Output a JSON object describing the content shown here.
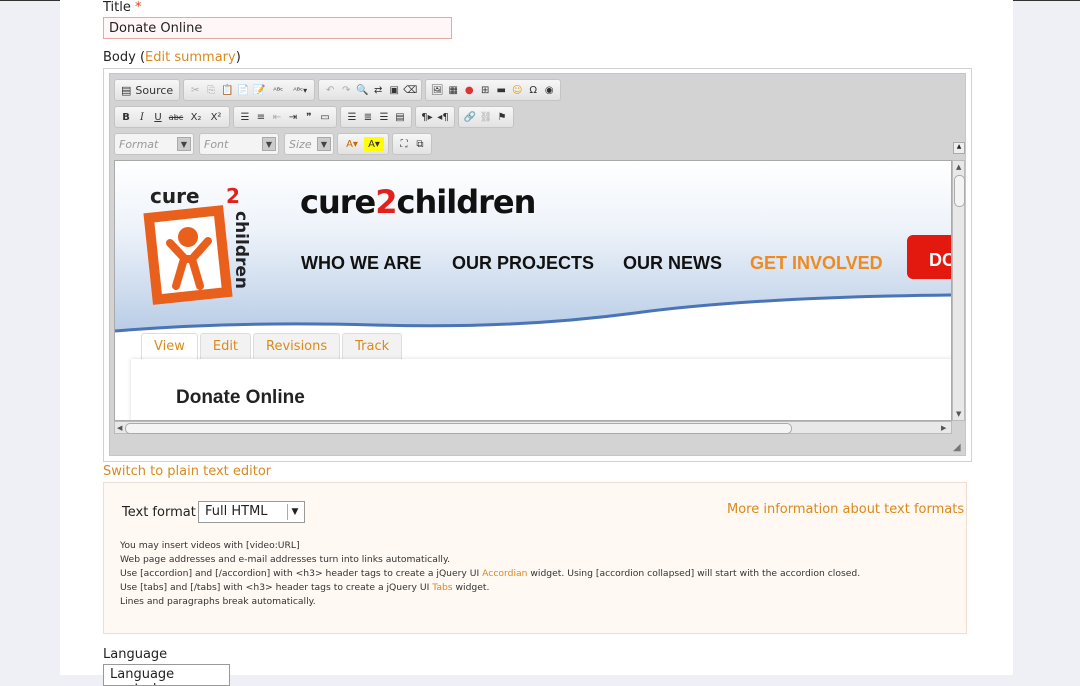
{
  "title_field": {
    "label": "Title",
    "required_mark": "*",
    "value": "Donate Online"
  },
  "body_field": {
    "label": "Body",
    "edit_summary_link": "Edit summary"
  },
  "toolbar": {
    "source_label": "Source",
    "format_placeholder": "Format",
    "font_placeholder": "Font",
    "size_placeholder": "Size"
  },
  "preview": {
    "brand_prefix": "cure",
    "brand_number": "2",
    "brand_suffix": "children",
    "logo_text_top": "cure",
    "logo_text_num": "2",
    "logo_text_side": "children",
    "nav": [
      "WHO WE ARE",
      "OUR PROJECTS",
      "OUR NEWS",
      "GET INVOLVED"
    ],
    "donate_button": "DO",
    "tabs": [
      "View",
      "Edit",
      "Revisions",
      "Track"
    ],
    "page_heading": "Donate Online"
  },
  "switch_editor_link": "Switch to plain text editor",
  "text_format": {
    "label": "Text format",
    "selected": "Full HTML",
    "more_info_link": "More information about text formats",
    "tips": {
      "line1": "You may insert videos with [video:URL]",
      "line2": "Web page addresses and e-mail addresses turn into links automatically.",
      "line3_pre": "Use [accordion] and [/accordion] with <h3> header tags to create a jQuery UI ",
      "line3_link": "Accordian",
      "line3_post": " widget. Using [accordion collapsed] will start with the accordion closed.",
      "line4_pre": "Use [tabs] and [/tabs] with <h3> header tags to create a jQuery UI ",
      "line4_link": "Tabs",
      "line4_post": " widget.",
      "line5": "Lines and paragraphs break automatically."
    }
  },
  "language_field": {
    "label": "Language",
    "selected": "Language neutral"
  },
  "colors": {
    "link": "#d98a1c",
    "brand_red": "#e3180f",
    "nav_orange": "#ee8a22"
  }
}
